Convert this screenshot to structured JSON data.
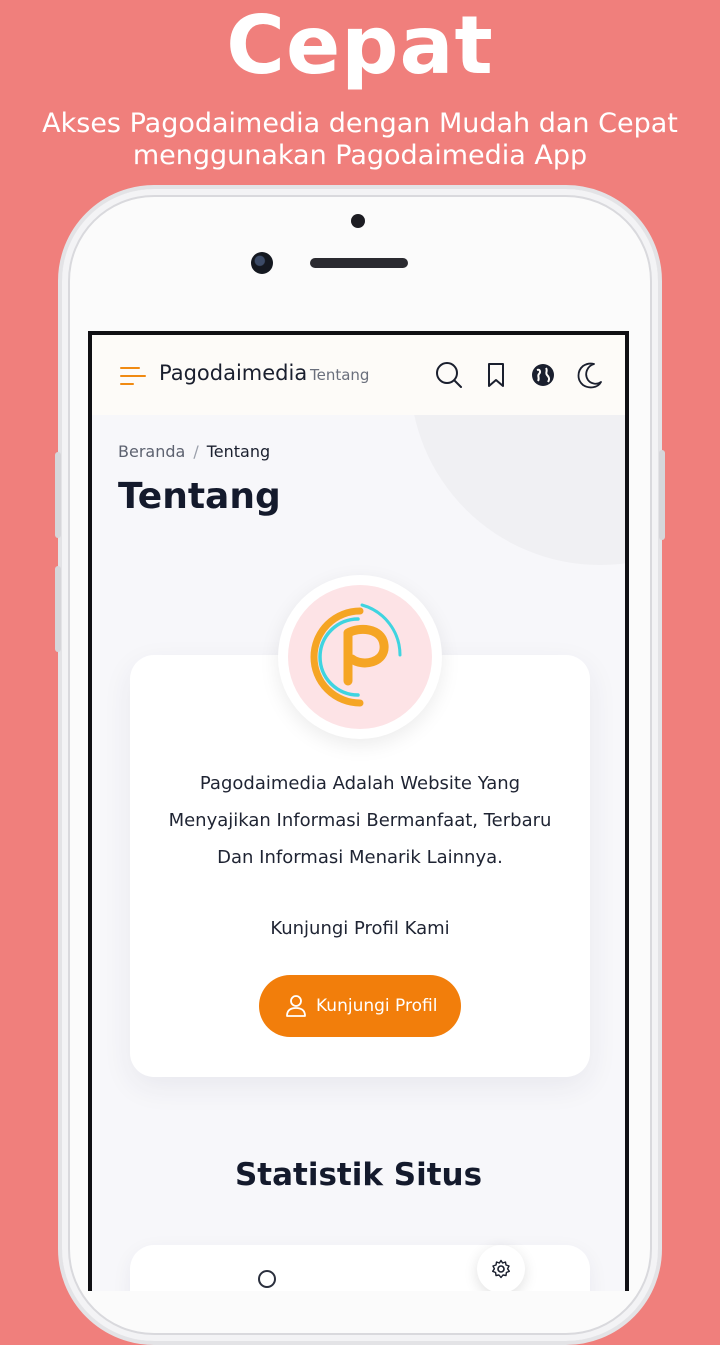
{
  "promo": {
    "headline": "Cepat",
    "subheadline": "Akses Pagodaimedia dengan Mudah dan Cepat menggunakan Pagodaimedia App"
  },
  "appbar": {
    "title": "Pagodaimedia",
    "subtitle": "Tentang",
    "icons": [
      "menu-icon",
      "search-icon",
      "bookmark-icon",
      "globe-icon",
      "moon-icon"
    ]
  },
  "breadcrumb": {
    "home": "Beranda",
    "separator": "/",
    "current": "Tentang"
  },
  "page": {
    "title": "Tentang"
  },
  "about_card": {
    "description": "Pagodaimedia Adalah Website Yang Menyajikan Informasi Bermanfaat, Terbaru Dan Informasi Menarik Lainnya.",
    "visit_text": "Kunjungi Profil Kami",
    "button_label": "Kunjungi Profil",
    "button_icon": "user-icon"
  },
  "stats": {
    "title": "Statistik Situs"
  },
  "colors": {
    "background": "#f07f7c",
    "accent": "#f27e0b",
    "logo_orange": "#f5a524",
    "logo_cyan": "#3fd4e0"
  }
}
